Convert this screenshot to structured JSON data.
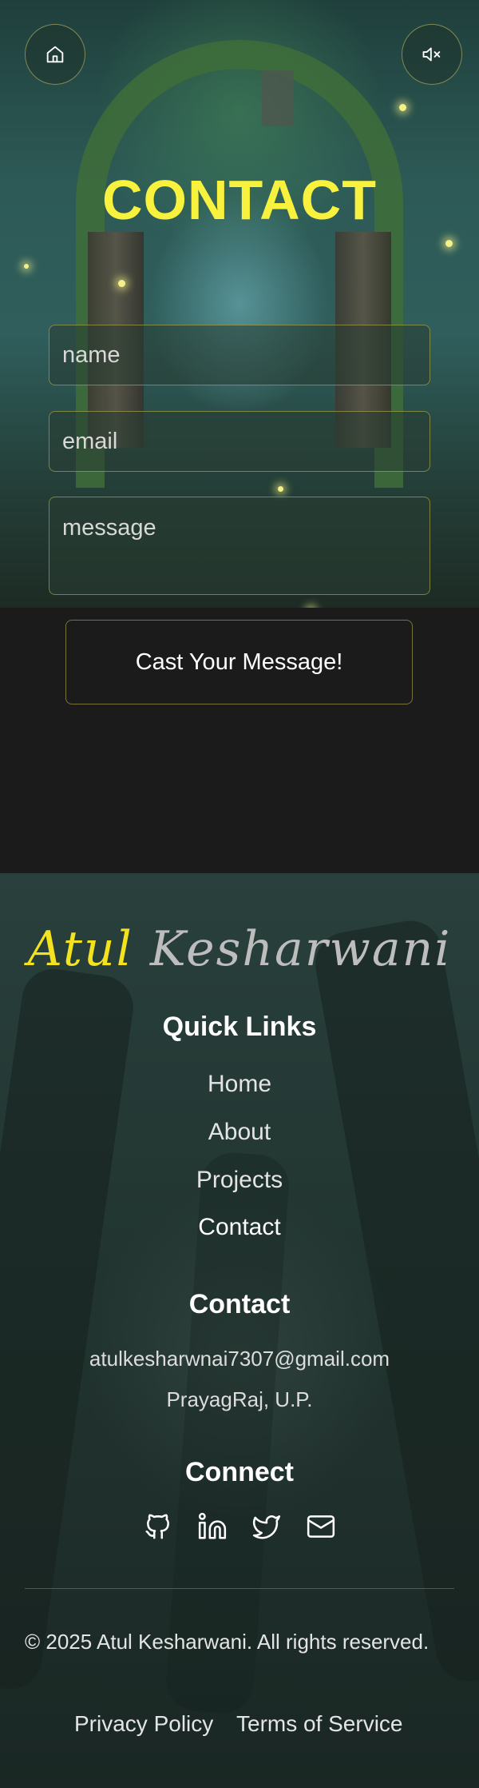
{
  "hero": {
    "title": "CONTACT",
    "home_button": "home-icon",
    "sound_button": "mute-icon"
  },
  "form": {
    "name_placeholder": "name",
    "email_placeholder": "email",
    "message_placeholder": "message",
    "submit_label": "Cast Your Message!"
  },
  "footer": {
    "logo_first": "Atul",
    "logo_last": "Kesharwani",
    "quick_links_heading": "Quick Links",
    "quick_links": [
      "Home",
      "About",
      "Projects",
      "Contact"
    ],
    "contact_heading": "Contact",
    "email": "atulkesharwnai7307@gmail.com",
    "location": "PrayagRaj, U.P.",
    "connect_heading": "Connect",
    "social_icons": [
      "github-icon",
      "linkedin-icon",
      "twitter-icon",
      "mail-icon"
    ],
    "copyright": "© 2025 Atul Kesharwani. All rights reserved.",
    "privacy": "Privacy Policy",
    "terms": "Terms of Service"
  },
  "colors": {
    "accent_yellow": "#f8f23e",
    "border_gold": "#c8be50",
    "page_bg": "#1b1b1b"
  }
}
